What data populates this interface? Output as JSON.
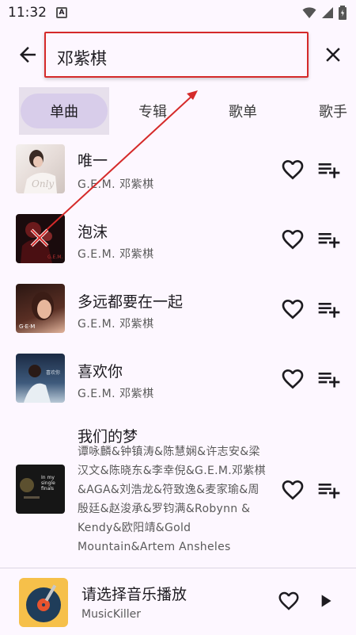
{
  "status": {
    "time": "11:32",
    "notification_icon": "a-icon"
  },
  "search": {
    "query": "邓紫棋",
    "back_icon": "arrow-left-icon",
    "clear_icon": "close-icon"
  },
  "tabs": [
    {
      "label": "单曲",
      "active": true
    },
    {
      "label": "专辑",
      "active": false
    },
    {
      "label": "歌单",
      "active": false
    },
    {
      "label": "歌手",
      "active": false
    }
  ],
  "songs": [
    {
      "title": "唯一",
      "artist": "G.E.M. 邓紫棋"
    },
    {
      "title": "泡沫",
      "artist": "G.E.M. 邓紫棋"
    },
    {
      "title": "多远都要在一起",
      "artist": "G.E.M. 邓紫棋"
    },
    {
      "title": "喜欢你",
      "artist": "G.E.M. 邓紫棋"
    },
    {
      "title": "我们的梦",
      "artist": "谭咏麟&钟镇涛&陈慧娴&许志安&梁汉文&陈晓东&李幸倪&G.E.M.邓紫棋&AGA&刘浩龙&符致逸&麦家瑜&周殷廷&赵浚承&罗钧满&Robynn & Kendy&欧阳靖&Gold Mountain&Artem Ansheles"
    }
  ],
  "song_actions": {
    "favorite_icon": "heart-outline-icon",
    "queue_icon": "playlist-add-icon"
  },
  "player": {
    "title": "请选择音乐播放",
    "subtitle": "MusicKiller",
    "favorite_icon": "heart-outline-icon",
    "play_icon": "play-icon"
  },
  "colors": {
    "background": "#fdf7ff",
    "tab_active": "#d8cdea",
    "annotation_red": "#d52a2a"
  }
}
